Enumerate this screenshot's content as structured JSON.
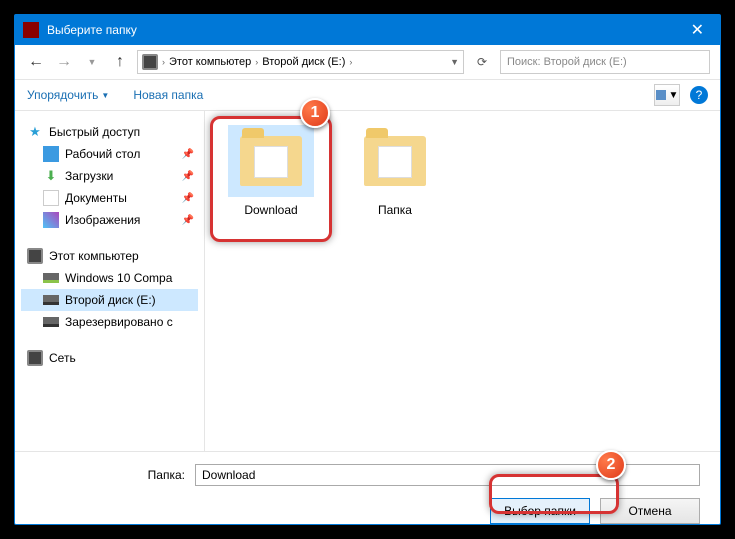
{
  "title": "Выберите папку",
  "breadcrumb": {
    "root": "Этот компьютер",
    "current": "Второй диск (E:)"
  },
  "search": {
    "placeholder": "Поиск: Второй диск (E:)"
  },
  "toolbar": {
    "organize": "Упорядочить",
    "newfolder": "Новая папка"
  },
  "tree": {
    "quick": "Быстрый доступ",
    "desktop": "Рабочий стол",
    "downloads": "Загрузки",
    "documents": "Документы",
    "pictures": "Изображения",
    "thispc": "Этот компьютер",
    "win10": "Windows 10 Compa",
    "disk2": "Второй диск (E:)",
    "reserved": "Зарезервировано с",
    "network": "Сеть"
  },
  "items": [
    {
      "label": "Download"
    },
    {
      "label": "Папка"
    }
  ],
  "footer": {
    "label": "Папка:",
    "value": "Download",
    "select": "Выбор папки",
    "cancel": "Отмена"
  },
  "badges": {
    "one": "1",
    "two": "2"
  }
}
